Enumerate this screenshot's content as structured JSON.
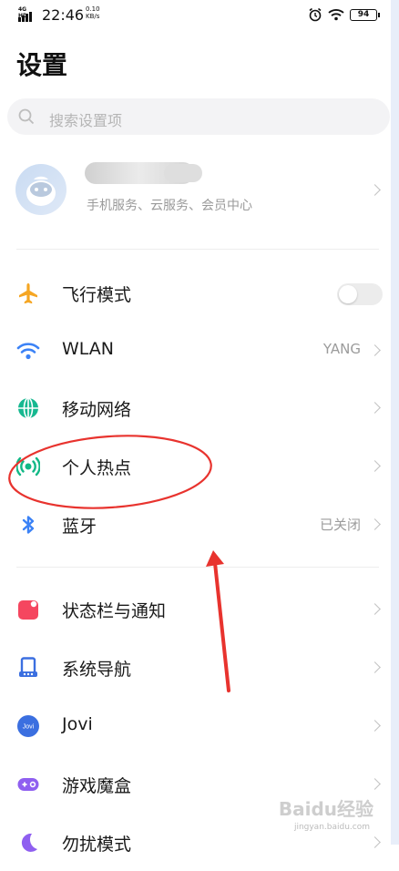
{
  "status_bar": {
    "network": "4G HD",
    "time": "22:46",
    "speed_value": "0.10",
    "speed_unit": "KB/s",
    "battery": "94"
  },
  "page_title": "设置",
  "search": {
    "placeholder": "搜索设置项"
  },
  "account": {
    "subtitle": "手机服务、云服务、会员中心"
  },
  "settings": [
    {
      "label": "飞行模式",
      "icon": "airplane-icon",
      "toggle": false
    },
    {
      "label": "WLAN",
      "icon": "wifi-icon",
      "value": "YANG"
    },
    {
      "label": "移动网络",
      "icon": "globe-icon"
    },
    {
      "label": "个人热点",
      "icon": "hotspot-icon"
    },
    {
      "label": "蓝牙",
      "icon": "bluetooth-icon",
      "value": "已关闭"
    },
    {
      "label": "状态栏与通知",
      "icon": "notification-icon"
    },
    {
      "label": "系统导航",
      "icon": "navigation-icon"
    },
    {
      "label": "Jovi",
      "icon": "jovi-icon",
      "icon_text": "Jovi"
    },
    {
      "label": "游戏魔盒",
      "icon": "game-box-icon"
    },
    {
      "label": "勿扰模式",
      "icon": "moon-icon"
    }
  ],
  "colors": {
    "airplane": "#f5a623",
    "wifi": "#3b82f6",
    "globe": "#16b890",
    "hotspot": "#12b886",
    "bluetooth": "#3b82f6",
    "notification": "#f5465f",
    "navigation": "#3b6fe0",
    "jovi": "#3b6fe0",
    "game": "#8f5ff0",
    "annotation": "#e8332e"
  },
  "watermark": {
    "brand": "Baidu经验",
    "url": "jingyan.baidu.com"
  }
}
